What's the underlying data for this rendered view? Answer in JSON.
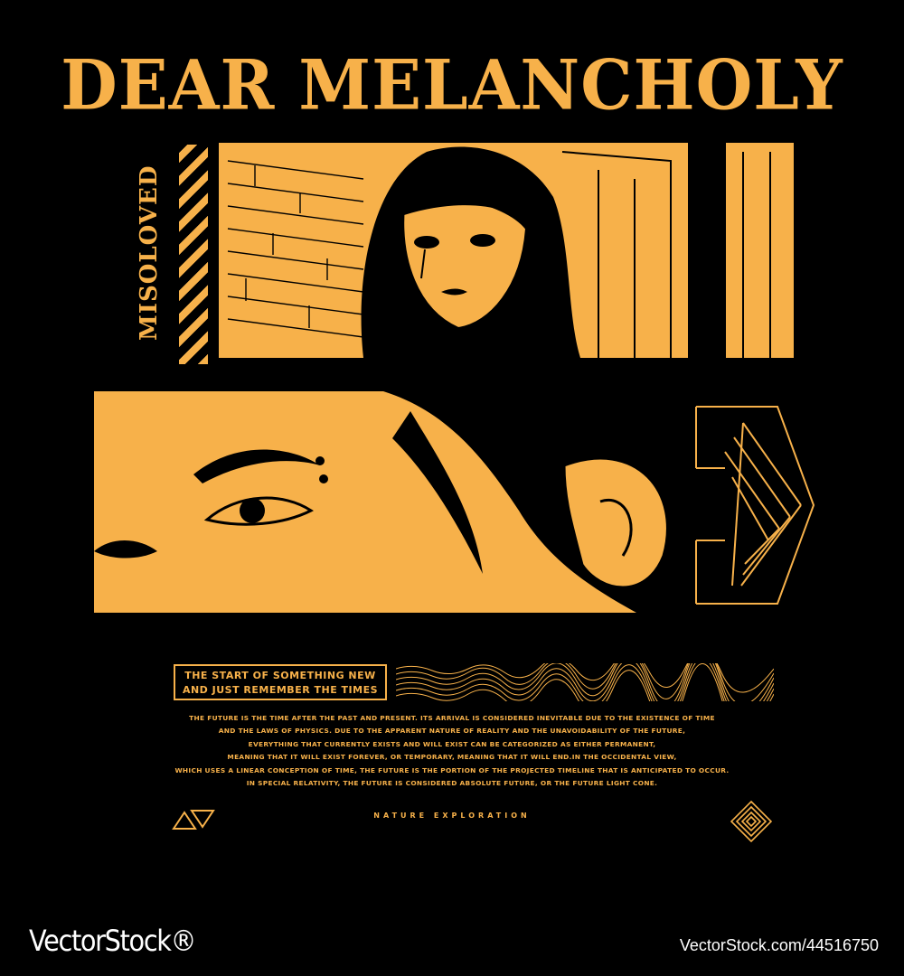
{
  "poster": {
    "title": "DEAR MELANCHOLY",
    "vertical_text": "MISOLOVED",
    "tagline_line1": "THE START OF SOMETHING NEW",
    "tagline_line2": "AND JUST REMEMBER THE TIMES",
    "body_lines": [
      "THE FUTURE IS THE TIME AFTER THE PAST AND PRESENT. ITS ARRIVAL IS CONSIDERED INEVITABLE DUE TO THE EXISTENCE OF TIME",
      "AND THE LAWS OF PHYSICS. DUE TO THE APPARENT NATURE OF REALITY AND THE UNAVOIDABILITY OF THE FUTURE,",
      "EVERYTHING THAT CURRENTLY EXISTS AND WILL EXIST CAN BE CATEGORIZED AS EITHER PERMANENT,",
      "MEANING THAT IT WILL EXIST FOREVER, OR TEMPORARY, MEANING THAT IT WILL END.IN THE OCCIDENTAL VIEW,",
      "WHICH USES A LINEAR CONCEPTION OF TIME, THE FUTURE IS THE PORTION OF THE PROJECTED TIMELINE THAT IS ANTICIPATED TO OCCUR.",
      "IN SPECIAL RELATIVITY, THE FUTURE IS CONSIDERED ABSOLUTE FUTURE, OR THE FUTURE LIGHT CONE."
    ],
    "footer_label": "NATURE EXPLORATION"
  },
  "watermark": {
    "brand": "VectorStock®",
    "id": "VectorStock.com/44516750"
  },
  "icons": {
    "triangles": "triangles-icon",
    "diamond": "nested-diamond-icon",
    "hexagon": "hexagon-frame-icon"
  },
  "colors": {
    "accent": "#f7b14a",
    "background": "#000000"
  }
}
